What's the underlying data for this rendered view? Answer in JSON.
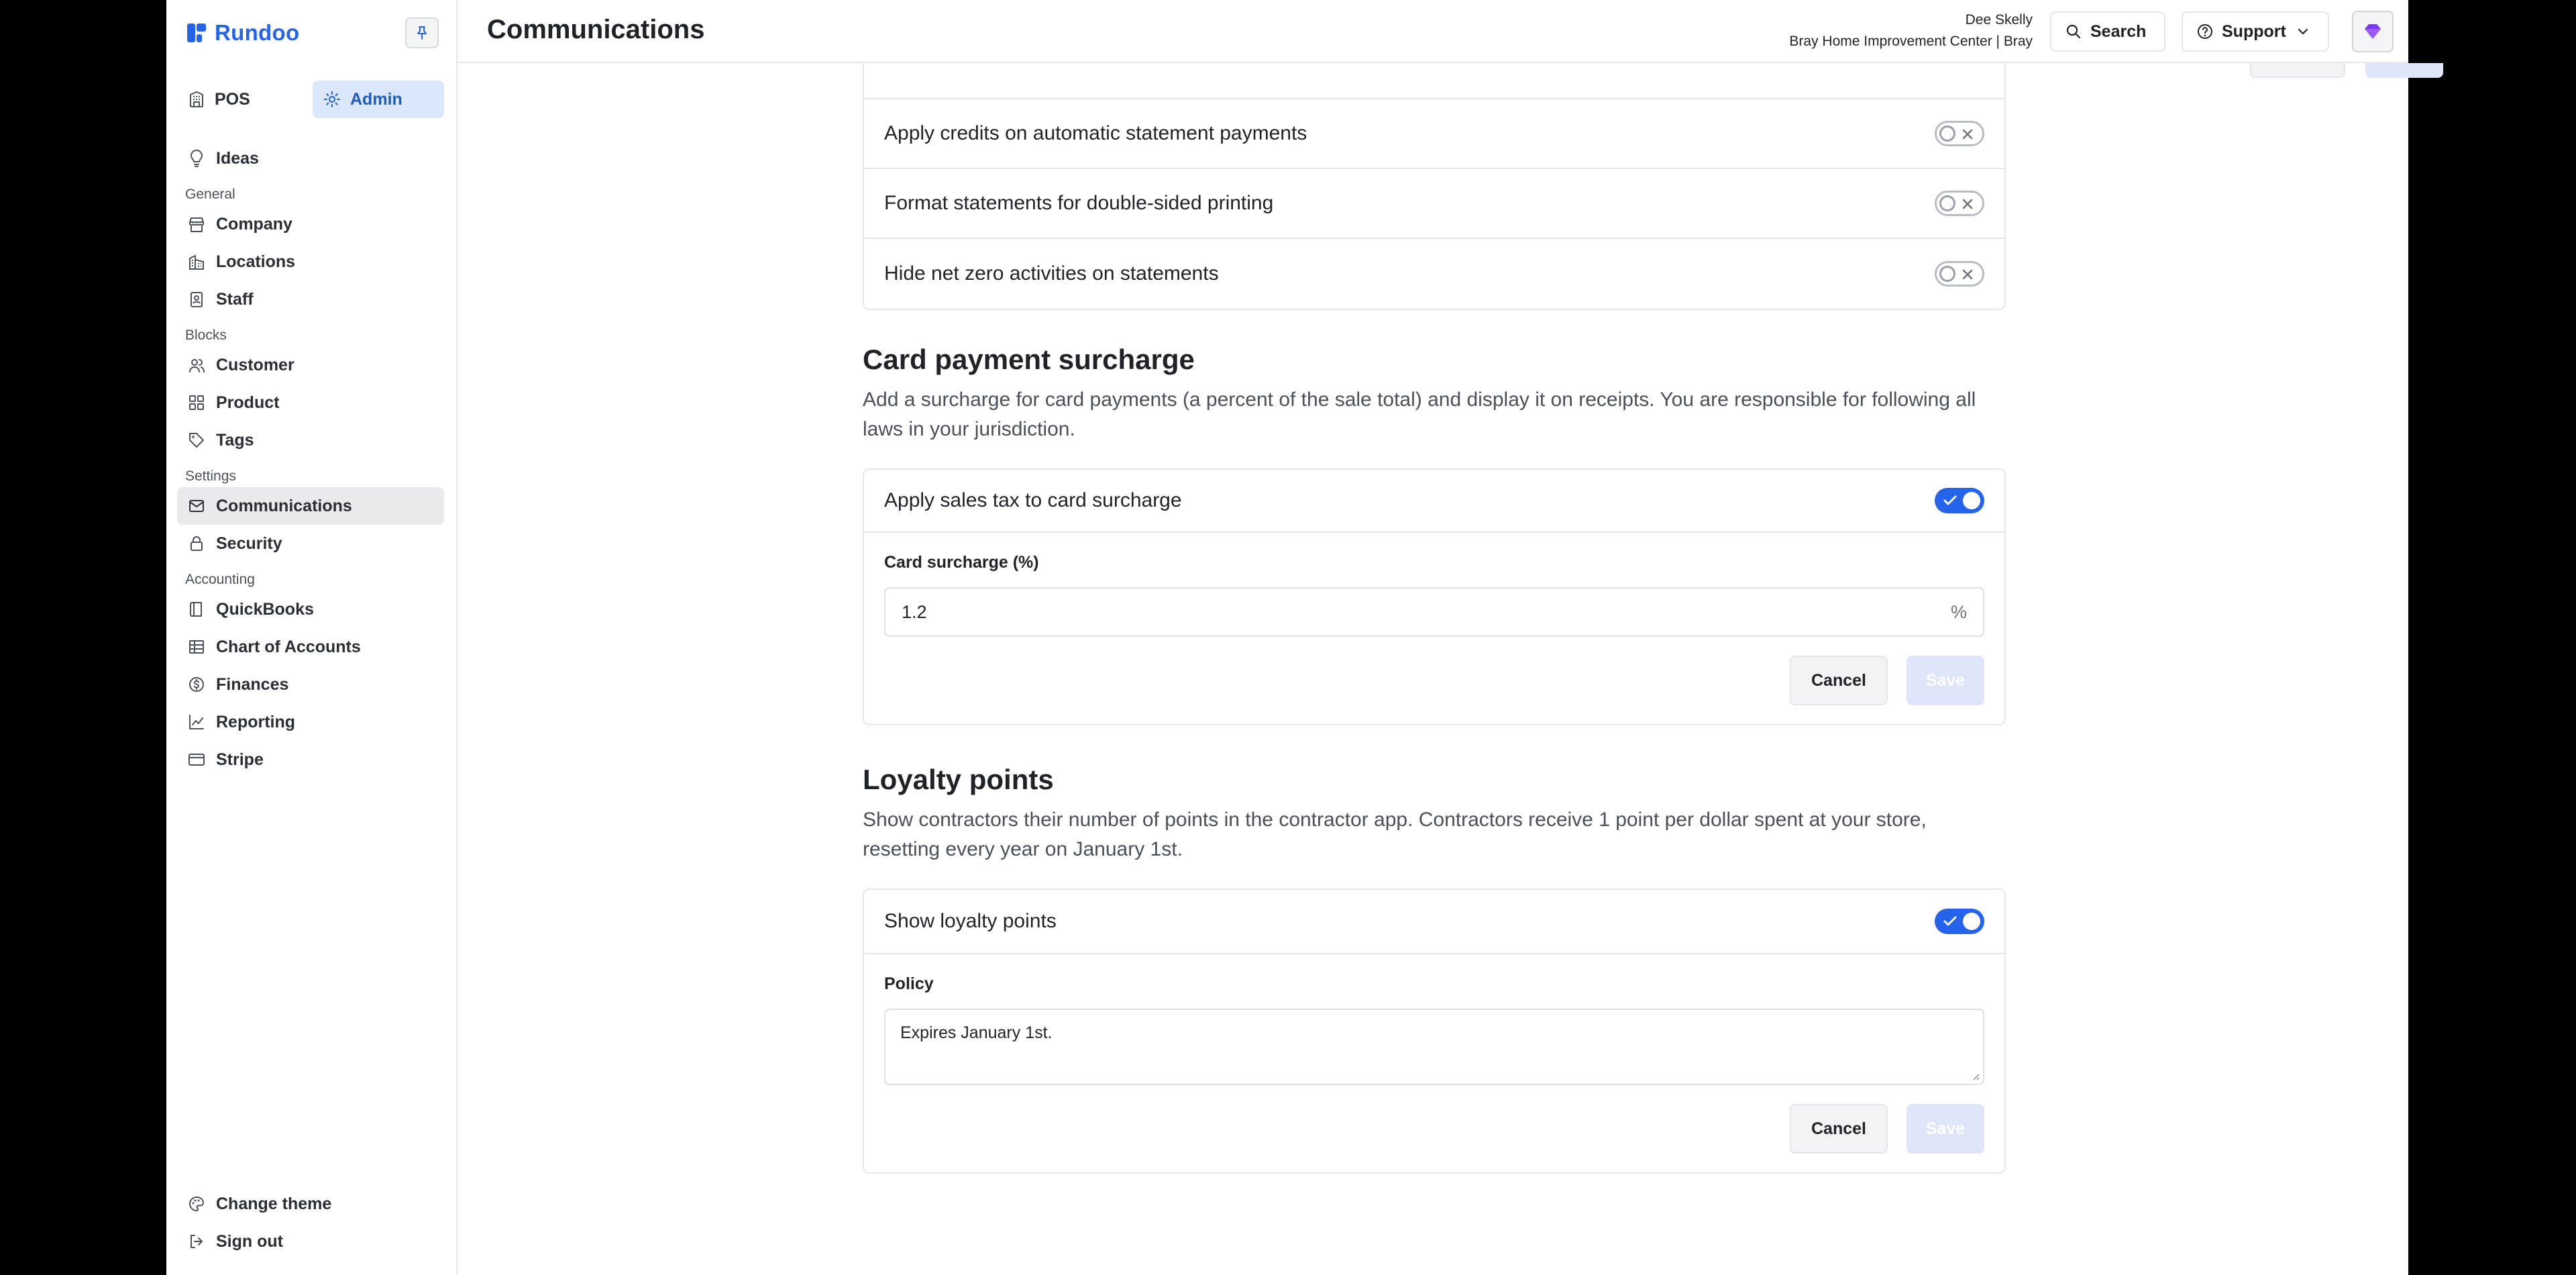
{
  "brand": {
    "name": "Rundoo"
  },
  "switch": {
    "pos": "POS",
    "admin": "Admin"
  },
  "sidebar": {
    "ideas": "Ideas",
    "groups": {
      "general": "General",
      "blocks": "Blocks",
      "settings": "Settings",
      "accounting": "Accounting"
    },
    "items": {
      "company": "Company",
      "locations": "Locations",
      "staff": "Staff",
      "customer": "Customer",
      "product": "Product",
      "tags": "Tags",
      "communications": "Communications",
      "security": "Security",
      "quickbooks": "QuickBooks",
      "chart_of_accounts": "Chart of Accounts",
      "finances": "Finances",
      "reporting": "Reporting",
      "stripe": "Stripe"
    },
    "bottom": {
      "change_theme": "Change theme",
      "sign_out": "Sign out"
    }
  },
  "header": {
    "title": "Communications",
    "user_name": "Dee Skelly",
    "user_org": "Bray Home Improvement Center | Bray",
    "search_label": "Search",
    "support_label": "Support"
  },
  "statements": {
    "rows": [
      {
        "label": "Apply credits on automatic statement payments",
        "enabled": false
      },
      {
        "label": "Format statements for double-sided printing",
        "enabled": false
      },
      {
        "label": "Hide net zero activities on statements",
        "enabled": false
      }
    ]
  },
  "card_surcharge": {
    "title": "Card payment surcharge",
    "description": "Add a surcharge for card payments (a percent of the sale total) and display it on receipts. You are responsible for following all laws in your jurisdiction.",
    "toggle_label": "Apply sales tax to card surcharge",
    "toggle_enabled": true,
    "field_label": "Card surcharge (%)",
    "field_value": "1.2",
    "field_suffix": "%",
    "cancel_label": "Cancel",
    "save_label": "Save"
  },
  "loyalty": {
    "title": "Loyalty points",
    "description": "Show contractors their number of points in the contractor app. Contractors receive 1 point per dollar spent at your store, resetting every year on January 1st.",
    "toggle_label": "Show loyalty points",
    "toggle_enabled": true,
    "field_label": "Policy",
    "field_value": "Expires January 1st.",
    "cancel_label": "Cancel",
    "save_label": "Save"
  },
  "colors": {
    "brand": "#2563eb",
    "admin_bg": "#dbe7fb",
    "active_bg": "#e9eaec",
    "toggle_on": "#2563eb",
    "save_disabled": "#dfe6f9"
  }
}
